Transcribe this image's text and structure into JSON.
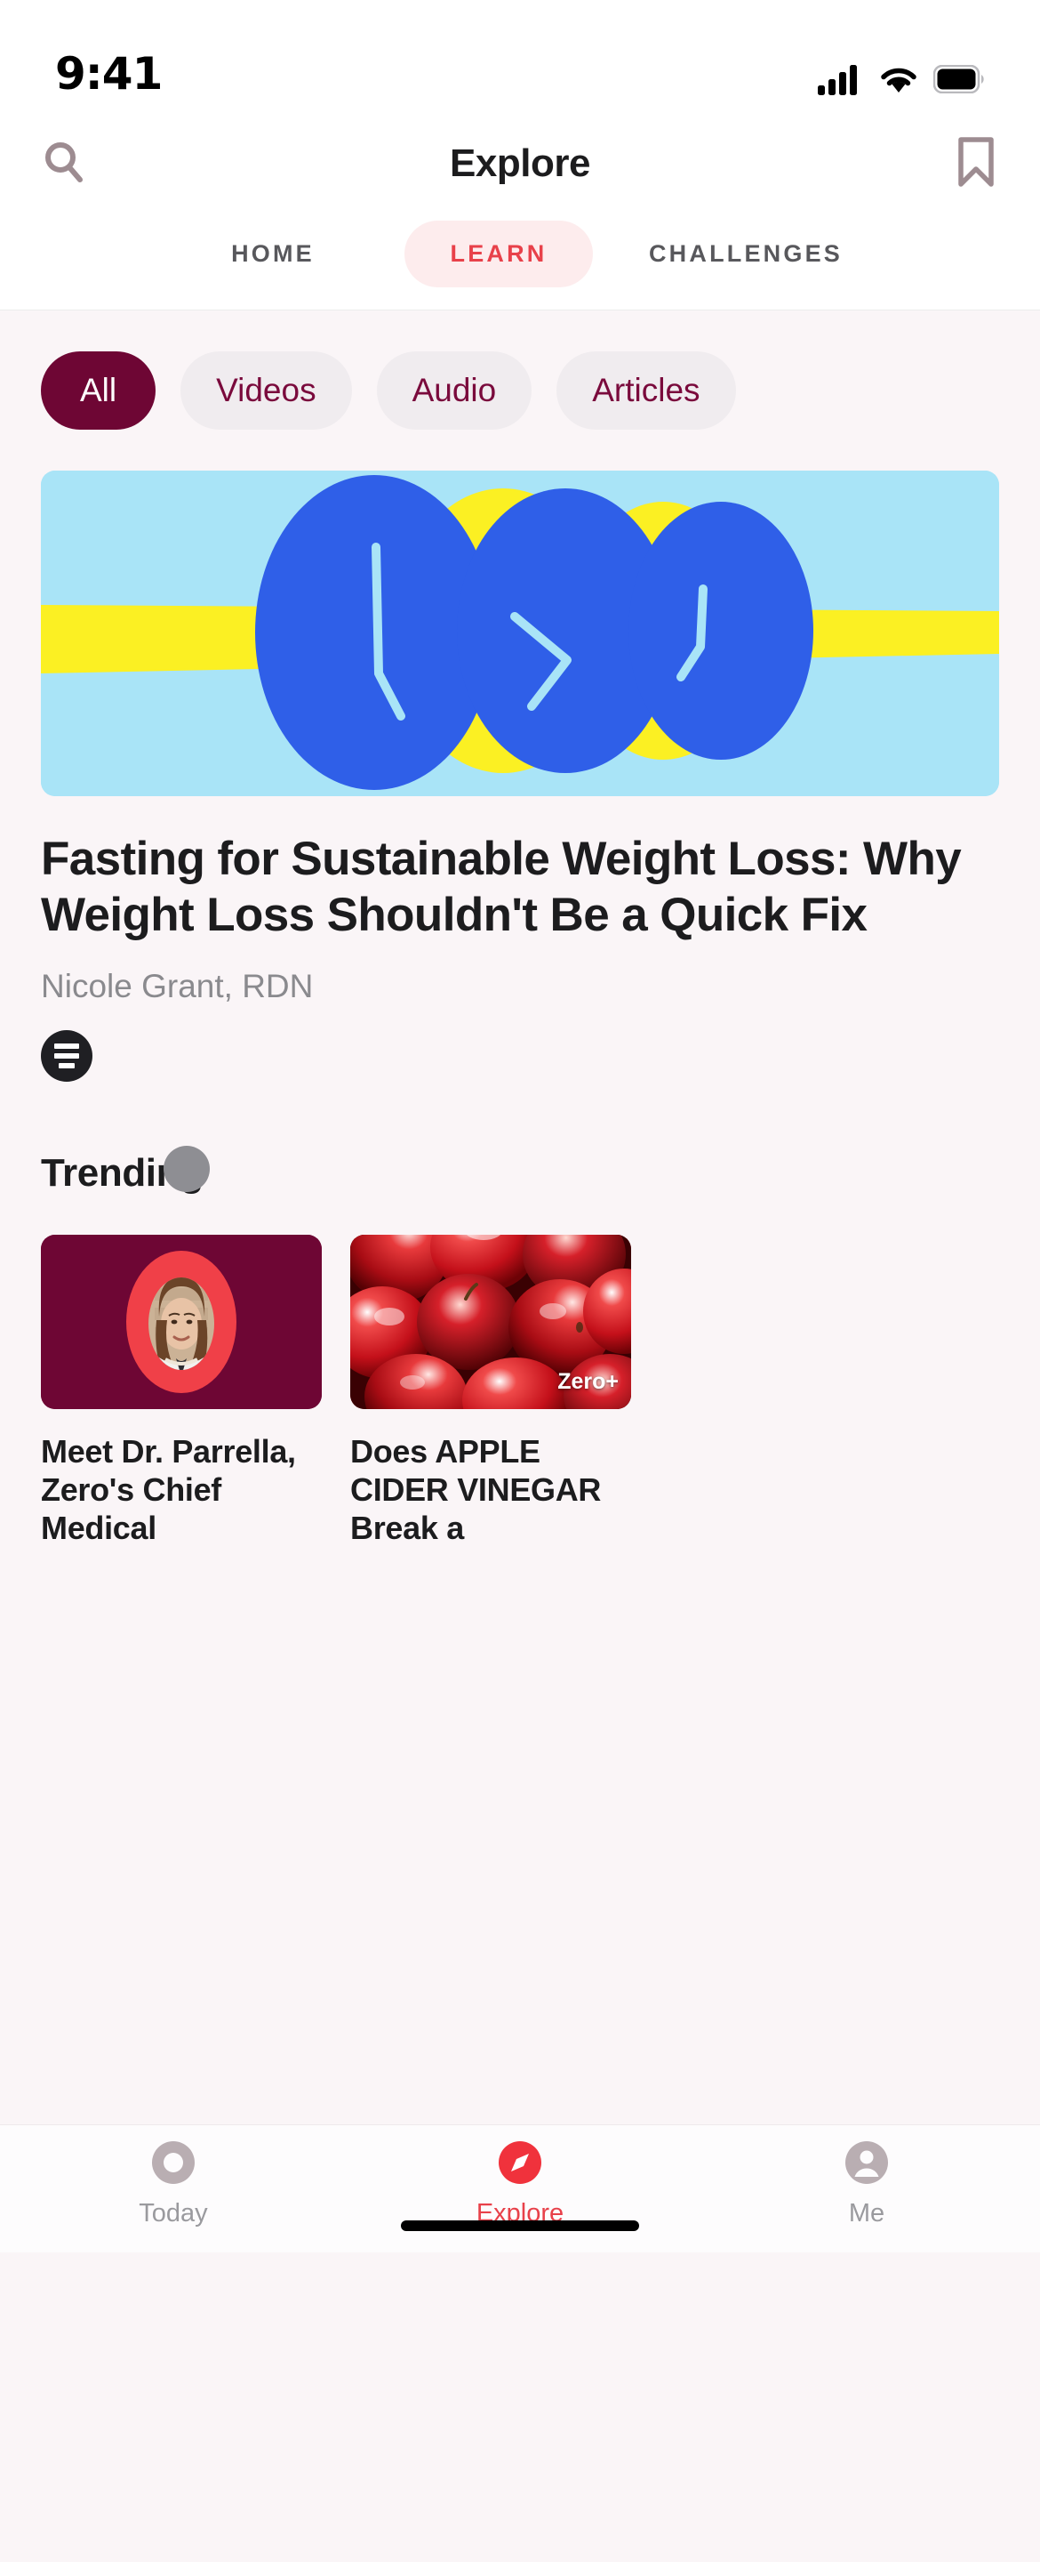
{
  "status_bar": {
    "time": "9:41",
    "icons": [
      "cellular-signal-icon",
      "wifi-icon",
      "battery-icon"
    ]
  },
  "header": {
    "title": "Explore",
    "left_icon": "search-icon",
    "right_icon": "bookmark-icon"
  },
  "segments": {
    "items": [
      {
        "label": "HOME",
        "active": false
      },
      {
        "label": "LEARN",
        "active": true
      },
      {
        "label": "CHALLENGES",
        "active": false
      }
    ],
    "active_color": "#e8414a",
    "active_bg": "#fdeced",
    "inactive_color": "#58585c"
  },
  "filters": {
    "chips": [
      {
        "label": "All",
        "active": true
      },
      {
        "label": "Videos",
        "active": false
      },
      {
        "label": "Audio",
        "active": false
      },
      {
        "label": "Articles",
        "active": false
      }
    ],
    "active_bg": "#6e0634",
    "active_text": "#ffffff",
    "inactive_bg": "#f0ecef",
    "inactive_text": "#7a0a3c"
  },
  "featured": {
    "image_alt": "abstract-clocks-illustration",
    "image_colors": {
      "background": "#a9e4f7",
      "band": "#fbf023",
      "ellipse": "#2f5fe8",
      "hands": "#a9e4f7"
    },
    "title": "Fasting for Sustainable Weight Loss: Why Weight Loss Shouldn't Be a Quick Fix",
    "author": "Nicole Grant, RDN",
    "media_type_icon": "article-icon"
  },
  "trending": {
    "heading": "Trending",
    "cards": [
      {
        "title": "Meet Dr. Parrella, Zero's Chief Medical",
        "image_alt": "portrait-doctor-parrella",
        "card_bg": "#6e0634",
        "ring_color": "#f04048",
        "badge": ""
      },
      {
        "title": "Does APPLE CIDER VINEGAR Break a",
        "image_alt": "red-apples-photo",
        "card_bg": "#b4151c",
        "badge": "Zero+"
      }
    ]
  },
  "bottom_nav": {
    "items": [
      {
        "label": "Today",
        "icon": "circle-icon",
        "active": false
      },
      {
        "label": "Explore",
        "icon": "compass-icon",
        "active": true
      },
      {
        "label": "Me",
        "icon": "person-icon",
        "active": false
      }
    ],
    "active_color": "#e8414a",
    "inactive_color": "#9a9a9e"
  }
}
